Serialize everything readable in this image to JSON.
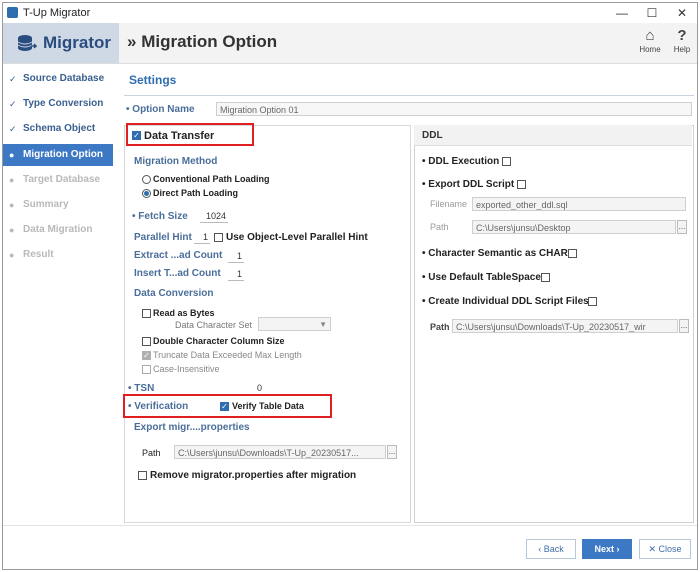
{
  "window": {
    "title": "T-Up Migrator"
  },
  "header": {
    "app_name": "Migrator",
    "page_title": "Migration Option",
    "page_title_prefix": "»",
    "home_label": "Home",
    "help_label": "Help"
  },
  "sidebar": {
    "items": [
      {
        "label": "Source Database",
        "state": "done"
      },
      {
        "label": "Type Conversion",
        "state": "done"
      },
      {
        "label": "Schema Object",
        "state": "done"
      },
      {
        "label": "Migration Option",
        "state": "active"
      },
      {
        "label": "Target Database",
        "state": "disabled"
      },
      {
        "label": "Summary",
        "state": "disabled"
      },
      {
        "label": "Data Migration",
        "state": "disabled"
      },
      {
        "label": "Result",
        "state": "disabled"
      }
    ]
  },
  "settings": {
    "title": "Settings",
    "option_name_label": "Option Name",
    "option_name_value": "Migration Option 01"
  },
  "data_transfer": {
    "label": "Data Transfer",
    "checked": true,
    "migration_method_label": "Migration Method",
    "conventional_label": "Conventional Path Loading",
    "direct_label": "Direct Path Loading",
    "fetch_size_label": "Fetch Size",
    "fetch_size_value": "1024",
    "parallel_hint_label": "Parallel Hint",
    "parallel_hint_value": "1",
    "use_object_level_label": "Use Object-Level Parallel Hint",
    "extract_label": "Extract ...ad Count",
    "extract_value": "1",
    "insert_label": "Insert T...ad Count",
    "insert_value": "1",
    "data_conversion_label": "Data Conversion",
    "read_as_bytes_label": "Read as Bytes",
    "data_charset_label": "Data Character Set",
    "double_char_label": "Double Character Column Size",
    "truncate_label": "Truncate Data Exceeded Max Length",
    "case_insensitive_label": "Case-Insensitive",
    "tsn_label": "TSN",
    "tsn_value": "0",
    "verification_label": "Verification",
    "verify_table_label": "Verify Table Data",
    "export_label": "Export migr....properties",
    "path_label": "Path",
    "path_value": "C:\\Users\\junsu\\Downloads\\T-Up_20230517...",
    "remove_label": "Remove migrator.properties after migration"
  },
  "ddl": {
    "title": "DDL",
    "ddl_execution_label": "DDL Execution",
    "export_ddl_label": "Export DDL Script",
    "filename_label": "Filename",
    "filename_value": "exported_other_ddl.sql",
    "path_label": "Path",
    "path_value": "C:\\Users\\junsu\\Desktop",
    "char_semantic_label": "Character Semantic as CHAR",
    "default_tablespace_label": "Use Default TableSpace",
    "individual_ddl_label": "Create Individual DDL Script Files",
    "individual_path_label": "Path",
    "individual_path_value": "C:\\Users\\junsu\\Downloads\\T-Up_20230517_wir"
  },
  "footer": {
    "back_label": "Back",
    "next_label": "Next",
    "close_label": "Close"
  },
  "icons": {
    "ellipsis": "...",
    "bullet": "•",
    "back_arrow": "‹",
    "next_arrow": "›",
    "close_x": "✕",
    "check": "✓"
  },
  "colors": {
    "accent": "#3d78c4",
    "highlight": "#e02020"
  }
}
